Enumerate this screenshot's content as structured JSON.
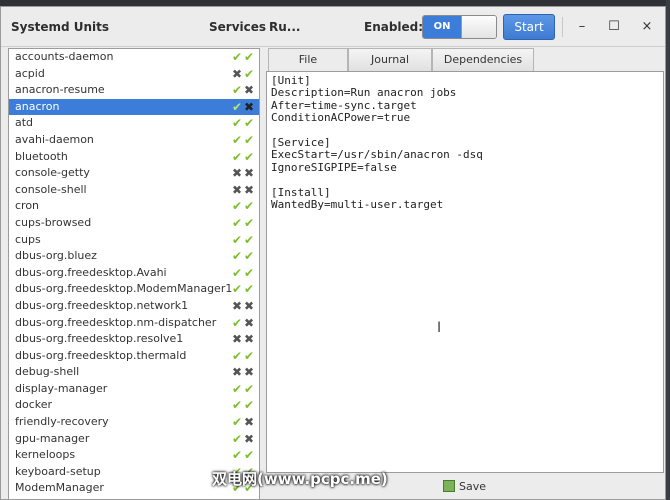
{
  "window": {
    "title": "Systemd Units",
    "services_label": "Services",
    "unit_label": "Ru...",
    "enabled_label": "Enabled:",
    "toggle_state": "ON",
    "start_label": "Start",
    "min_glyph": "–",
    "max_glyph": "☐",
    "close_glyph": "×"
  },
  "units": [
    {
      "name": "accounts-daemon",
      "enabled": "check",
      "active": "check"
    },
    {
      "name": "acpid",
      "enabled": "cross",
      "active": "check"
    },
    {
      "name": "anacron-resume",
      "enabled": "check",
      "active": "cross"
    },
    {
      "name": "anacron",
      "enabled": "check",
      "active": "cross",
      "selected": true
    },
    {
      "name": "atd",
      "enabled": "check",
      "active": "check"
    },
    {
      "name": "avahi-daemon",
      "enabled": "check",
      "active": "check"
    },
    {
      "name": "bluetooth",
      "enabled": "check",
      "active": "check"
    },
    {
      "name": "console-getty",
      "enabled": "cross",
      "active": "cross"
    },
    {
      "name": "console-shell",
      "enabled": "cross",
      "active": "cross"
    },
    {
      "name": "cron",
      "enabled": "check",
      "active": "check"
    },
    {
      "name": "cups-browsed",
      "enabled": "check",
      "active": "check"
    },
    {
      "name": "cups",
      "enabled": "check",
      "active": "check"
    },
    {
      "name": "dbus-org.bluez",
      "enabled": "check",
      "active": "check"
    },
    {
      "name": "dbus-org.freedesktop.Avahi",
      "enabled": "check",
      "active": "check"
    },
    {
      "name": "dbus-org.freedesktop.ModemManager1",
      "enabled": "check",
      "active": "check"
    },
    {
      "name": "dbus-org.freedesktop.network1",
      "enabled": "cross",
      "active": "cross"
    },
    {
      "name": "dbus-org.freedesktop.nm-dispatcher",
      "enabled": "check",
      "active": "cross"
    },
    {
      "name": "dbus-org.freedesktop.resolve1",
      "enabled": "cross",
      "active": "cross"
    },
    {
      "name": "dbus-org.freedesktop.thermald",
      "enabled": "check",
      "active": "check"
    },
    {
      "name": "debug-shell",
      "enabled": "cross",
      "active": "cross"
    },
    {
      "name": "display-manager",
      "enabled": "check",
      "active": "check"
    },
    {
      "name": "docker",
      "enabled": "check",
      "active": "check"
    },
    {
      "name": "friendly-recovery",
      "enabled": "check",
      "active": "cross"
    },
    {
      "name": "gpu-manager",
      "enabled": "check",
      "active": "cross"
    },
    {
      "name": "kerneloops",
      "enabled": "check",
      "active": "check"
    },
    {
      "name": "keyboard-setup",
      "enabled": "check",
      "active": "check"
    },
    {
      "name": "ModemManager",
      "enabled": "check",
      "active": "check"
    }
  ],
  "tabs": [
    {
      "label": "File",
      "active": true
    },
    {
      "label": "Journal",
      "active": false
    },
    {
      "label": "Dependencies",
      "active": false
    }
  ],
  "file_content": [
    "[Unit]",
    "Description=Run anacron jobs",
    "After=time-sync.target",
    "ConditionACPower=true",
    "",
    "[Service]",
    "ExecStart=/usr/sbin/anacron -dsq",
    "IgnoreSIGPIPE=false",
    "",
    "[Install]",
    "WantedBy=multi-user.target"
  ],
  "footer": {
    "save_label": "Save"
  },
  "watermark": "双电网(www.pcpc.me)",
  "colors": {
    "accent": "#3b7dd8",
    "check": "#7cbf2a",
    "cross": "#555555"
  }
}
